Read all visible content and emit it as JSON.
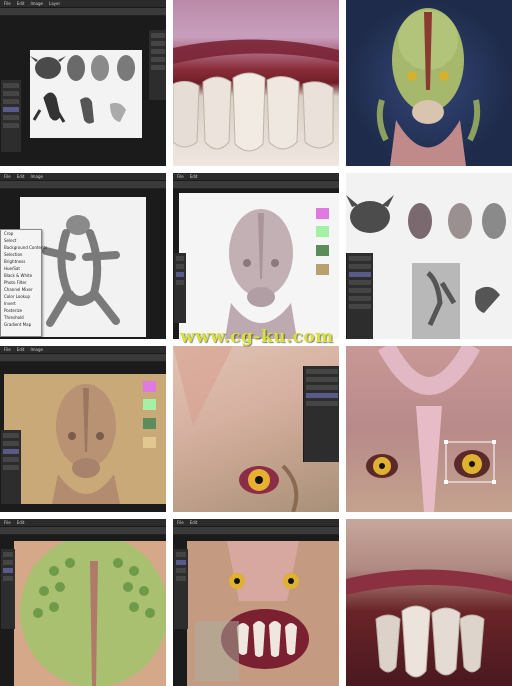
{
  "watermark": "www.cg-ku.com",
  "ps_menu": [
    "File",
    "Edit",
    "Image",
    "Layer",
    "Type",
    "Select",
    "Filter",
    "3D",
    "View",
    "Window",
    "Help"
  ],
  "context_menu": {
    "items": [
      "Crop",
      "Select",
      "Background Contents",
      "",
      "Selection",
      "Brightness",
      "Hue/Sat",
      "Black & White",
      "Photo Filter",
      "Channel Mixer",
      "Color Lookup",
      "Invert",
      "Posterize",
      "Threshold",
      "Gradient Map",
      "Selective Color"
    ]
  },
  "colors": {
    "ps_dark": "#2b2b2b",
    "canvas_gray": "#f2f2f2",
    "tan_bg": "#c9a978",
    "night_bg": "#1e2b4a",
    "swatch_pink": "#e07ae0",
    "swatch_mint": "#a4f0a4",
    "swatch_green": "#5c8c5c",
    "swatch_tan": "#b8a070",
    "watermark": "#d8e03c"
  },
  "tiles": [
    {
      "subject": "photoshop-sketch-sheet-icon"
    },
    {
      "subject": "teeth-closeup-icon"
    },
    {
      "subject": "alien-bust-final-icon"
    },
    {
      "subject": "creature-sculpt-menu-icon"
    },
    {
      "subject": "alien-bust-gray-icon"
    },
    {
      "subject": "concept-sheet-icon"
    },
    {
      "subject": "alien-bust-tan-icon"
    },
    {
      "subject": "eye-closeup-icon"
    },
    {
      "subject": "eye-transform-icon"
    },
    {
      "subject": "scalp-pattern-icon"
    },
    {
      "subject": "mouth-texture-icon"
    },
    {
      "subject": "mouth-closeup-icon"
    }
  ]
}
